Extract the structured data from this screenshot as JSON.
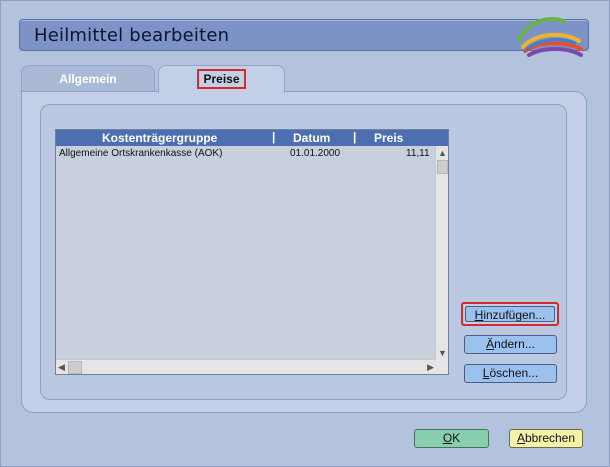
{
  "window": {
    "title": "Heilmittel bearbeiten"
  },
  "tabs": [
    {
      "label": "Allgemein",
      "selected": false
    },
    {
      "label": "Preise",
      "selected": true
    }
  ],
  "list": {
    "headers": [
      "Kostenträgergruppe",
      "Datum",
      "Preis"
    ],
    "separator": "|",
    "rows": [
      {
        "kostentraegergruppe": "Allgemeine Ortskrankenkasse (AOK)",
        "datum": "01.01.2000",
        "preis": "11,11"
      }
    ]
  },
  "buttons": {
    "hinzufuegen": {
      "mnemonic": "H",
      "rest": "inzufügen..."
    },
    "aendern": {
      "mnemonic": "Ä",
      "rest": "ndern..."
    },
    "loeschen": {
      "mnemonic": "L",
      "rest": "öschen..."
    },
    "ok": {
      "mnemonic": "O",
      "rest": "K"
    },
    "abbrechen": {
      "mnemonic": "A",
      "rest": "bbrechen"
    }
  },
  "colors": {
    "title_bar": "#7d92c7",
    "header": "#4d6fb2",
    "action_button": "#9bc1ef",
    "ok_button": "#88cfae",
    "cancel_button": "#f4f3a8",
    "highlight": "#d12b2b"
  },
  "icons": {
    "logo": "swoosh-logo-icon"
  }
}
